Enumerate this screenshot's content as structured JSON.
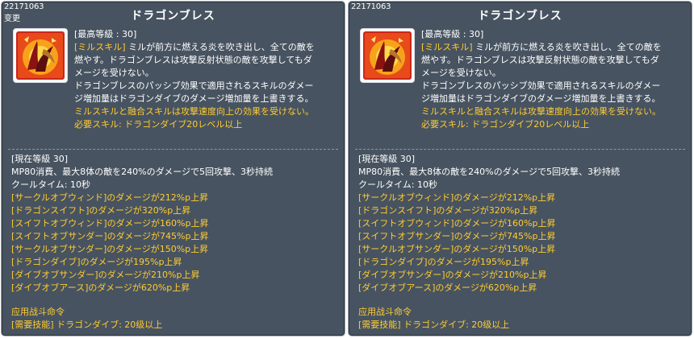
{
  "colors": {
    "panel_bg": "#475360",
    "border": "#9aa3ad",
    "highlight_text": "#ffcc33",
    "normal_text": "#ffffff"
  },
  "panels": [
    {
      "skill_id": "22171063",
      "change_tag": "变更",
      "title": "ドラゴンブレス",
      "icon": "dragon-breath-skill-icon",
      "desc": {
        "max_level": "[最高等級 : 30]",
        "line1_prefix": "[ミルスキル]",
        "line1_rest": " ミルが前方に燃える炎を吹き出し、全ての敵を",
        "line2": "燃やす。ドラゴンブレスは攻撃反射状態の敵を攻撃してもダ",
        "line3": "メージを受けない。",
        "line4": "ドラゴンブレスのパッシブ効果で適用されるスキルのダメー",
        "line5": "ジ増加量はドラゴンダイブのダメージ増加量を上書きする。",
        "line6": "ミルスキルと融合スキルは攻撃速度向上の効果を受けない。",
        "line7": "必要スキル: ドラゴンダイブ20レベル以上"
      },
      "current": {
        "level": "[現在等級 30]",
        "mp_line": "MP80消費、最大8体の敵を240%のダメージで5回攻撃、3秒持続",
        "cooldown": "クールタイム: 10秒",
        "skills": [
          "[サークルオブウィンド]のダメージが212%p上昇",
          "[ドラゴンスイフト]のダメージが320%p上昇",
          "[スイフトオブウィンド]のダメージが160%p上昇",
          "[スイフトオブサンダー]のダメージが745%p上昇",
          "[サークルオブサンダー]のダメージが150%p上昇",
          "[ドラゴンダイブ]のダメージが195%p上昇",
          "[ダイブオブサンダー]のダメージが210%p上昇",
          "[ダイブオブアース]のダメージが620%p上昇"
        ]
      },
      "footer": {
        "line1": "应用战斗命令",
        "line2": "[需要技能] ドラゴンダイブ: 20级以上"
      }
    },
    {
      "skill_id": "22171063",
      "change_tag": "",
      "title": "ドラゴンブレス",
      "icon": "dragon-breath-skill-icon",
      "desc": {
        "max_level": "[最高等級 : 30]",
        "line1_prefix": "[ミルスキル]",
        "line1_rest": " ミルが前方に燃える炎を吹き出し、全ての敵を",
        "line2": "燃やす。ドラゴンブレスは攻撃反射状態の敵を攻撃してもダ",
        "line3": "メージを受けない。",
        "line4": "ドラゴンブレスのパッシブ効果で適用されるスキルのダメー",
        "line5": "ジ増加量はドラゴンダイブのダメージ増加量を上書きする。",
        "line6": "ミルスキルと融合スキルは攻撃速度向上の効果を受けない。",
        "line7": "必要スキル: ドラゴンダイブ20レベル以上"
      },
      "current": {
        "level": "[現在等級 30]",
        "mp_line": "MP80消費、最大8体の敵を240%のダメージで5回攻撃、3秒持続",
        "cooldown": "クールタイム: 10秒",
        "skills": [
          "[サークルオブウィンド]のダメージが212%p上昇",
          "[ドラゴンスイフト]のダメージが320%p上昇",
          "[スイフトオブウィンド]のダメージが160%p上昇",
          "[スイフトオブサンダー]のダメージが745%p上昇",
          "[サークルオブサンダー]のダメージが150%p上昇",
          "[ドラゴンダイブ]のダメージが195%p上昇",
          "[ダイブオブサンダー]のダメージが210%p上昇",
          "[ダイブオブアース]のダメージが620%p上昇"
        ]
      },
      "footer": {
        "line1": "应用战斗命令",
        "line2": "[需要技能] ドラゴンダイブ: 20级以上"
      }
    }
  ]
}
